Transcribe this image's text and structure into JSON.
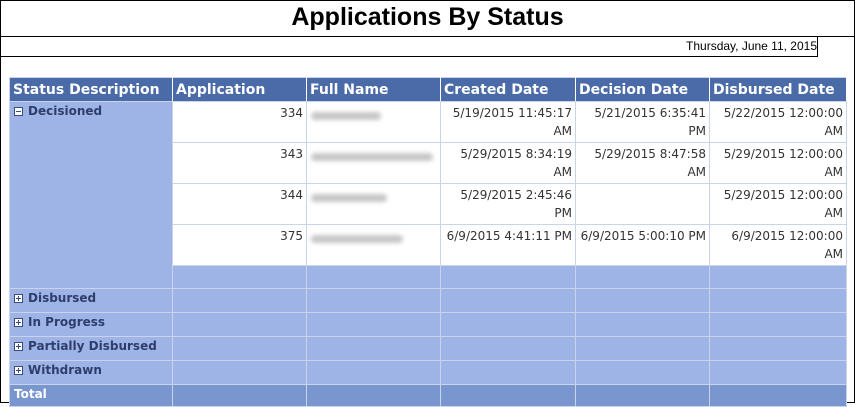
{
  "report": {
    "title": "Applications By Status",
    "date": "Thursday, June 11, 2015"
  },
  "table": {
    "headers": [
      "Status Description",
      "Application",
      "Full Name",
      "Created Date",
      "Decision Date",
      "Disbursed Date"
    ],
    "groups": [
      {
        "label": "Decisioned",
        "expanded": true,
        "rows": [
          {
            "application": "334",
            "full_name": "",
            "created": "5/19/2015 11:45:17 AM",
            "decision": "5/21/2015 6:35:41 PM",
            "disbursed": "5/22/2015 12:00:00 AM"
          },
          {
            "application": "343",
            "full_name": "",
            "created": "5/29/2015 8:34:19 AM",
            "decision": "5/29/2015 8:47:58 AM",
            "disbursed": "5/29/2015 12:00:00 AM"
          },
          {
            "application": "344",
            "full_name": "",
            "created": "5/29/2015 2:45:46 PM",
            "decision": "",
            "disbursed": "5/29/2015 12:00:00 AM"
          },
          {
            "application": "375",
            "full_name": "",
            "created": "6/9/2015 4:41:11 PM",
            "decision": "6/9/2015 5:00:10 PM",
            "disbursed": "6/9/2015 12:00:00 AM"
          }
        ]
      },
      {
        "label": "Disbursed",
        "expanded": false
      },
      {
        "label": "In Progress",
        "expanded": false
      },
      {
        "label": "Partially Disbursed",
        "expanded": false
      },
      {
        "label": "Withdrawn",
        "expanded": false
      }
    ],
    "total_label": "Total"
  },
  "colors": {
    "header_bg": "#4a6aa8",
    "group_bg": "#9fb4e6",
    "total_bg": "#7a96cf"
  }
}
